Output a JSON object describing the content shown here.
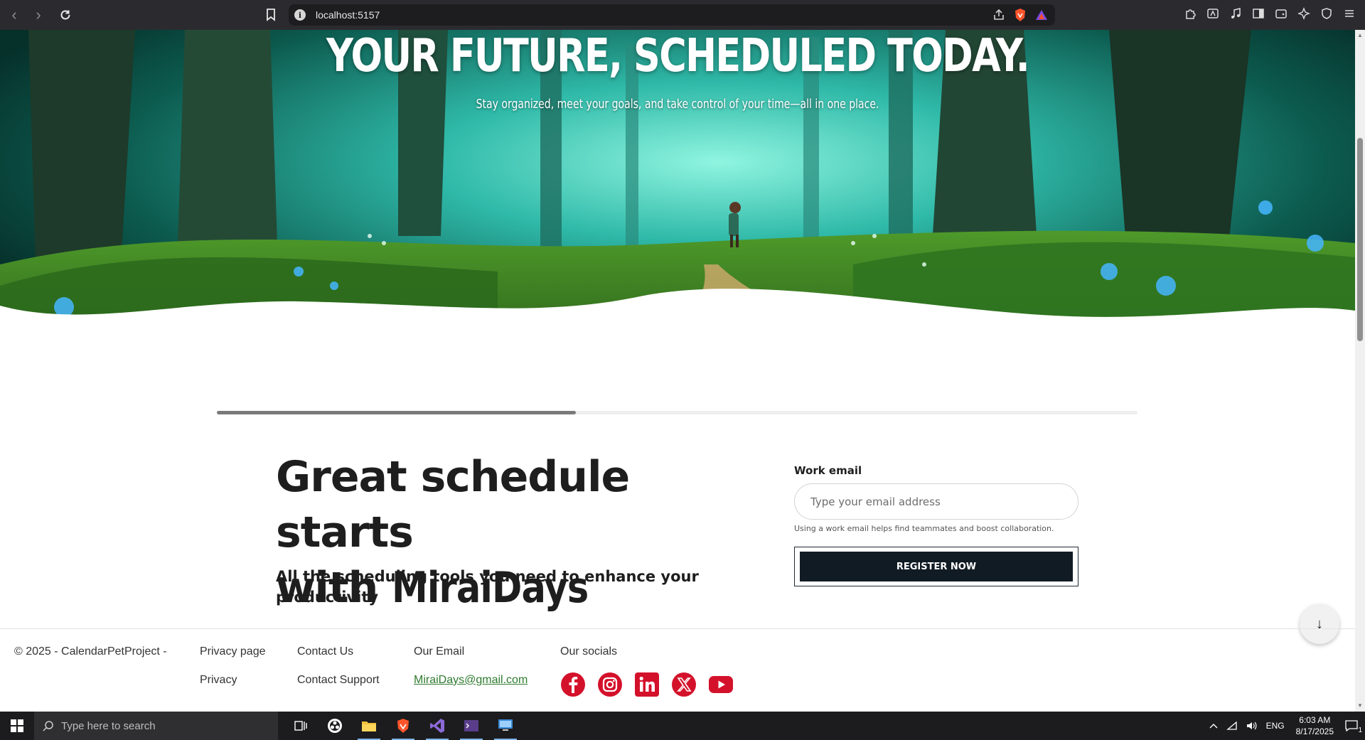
{
  "browser": {
    "url": "localhost:5157"
  },
  "hero": {
    "title": "YOUR FUTURE, SCHEDULED TODAY.",
    "subtitle": "Stay organized, meet your goals, and take control of your time—all in one place."
  },
  "progress": {
    "fraction": 0.39
  },
  "main": {
    "headline_line1": "Great schedule starts",
    "headline_line2_prefix": "with ",
    "headline_brand": "MiraiDays",
    "subhead": "All the scheduling tools you need to enhance your productivity"
  },
  "form": {
    "label": "Work email",
    "placeholder": "Type your email address",
    "value": "",
    "hint": "Using a work email helps find teammates and boost collaboration.",
    "register_label": "REGISTER NOW"
  },
  "scroll_button": {
    "icon": "arrow-down-icon",
    "glyph": "↓"
  },
  "footer": {
    "copyright": "© 2025 - CalendarPetProject -",
    "col1": [
      "Privacy page",
      "Privacy"
    ],
    "col2": [
      "Contact Us",
      "Contact Support"
    ],
    "email_title": "Our Email",
    "email": "MiraiDays@gmail.com",
    "socials_title": "Our socials",
    "socials": [
      "facebook-icon",
      "instagram-icon",
      "linkedin-icon",
      "x-icon",
      "youtube-icon"
    ],
    "social_color": "#d4112b"
  },
  "taskbar": {
    "search_placeholder": "Type here to search",
    "language": "ENG",
    "time": "6:03 AM",
    "date": "8/17/2025",
    "notification_count": "1"
  }
}
